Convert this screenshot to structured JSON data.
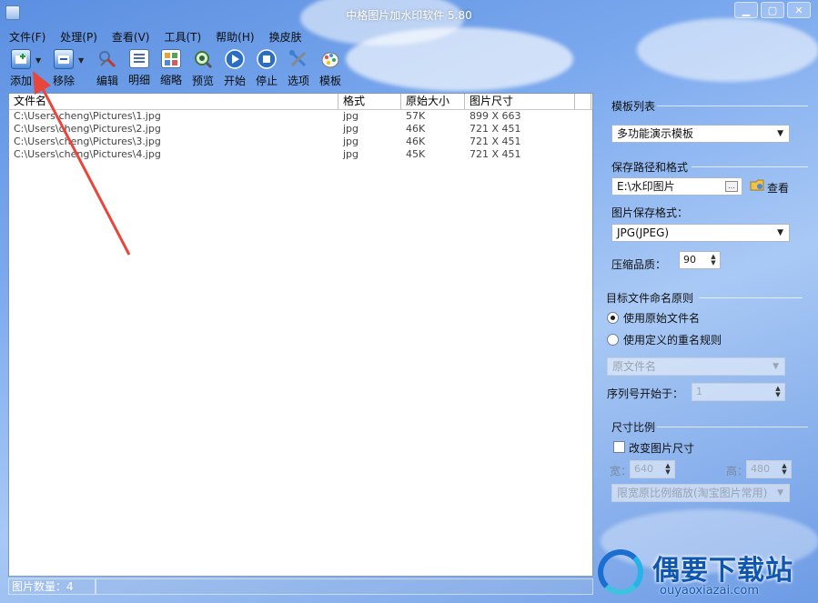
{
  "window": {
    "title": "中格图片加水印软件 5.80",
    "controls": [
      "▁",
      "▢",
      "✕"
    ]
  },
  "menu": [
    "文件(F)",
    "处理(P)",
    "查看(V)",
    "工具(T)",
    "帮助(H)",
    "换皮肤"
  ],
  "toolbar": [
    {
      "label": "添加",
      "icon": "add-image-icon",
      "dropdown": true
    },
    {
      "label": "移除",
      "icon": "remove-image-icon",
      "dropdown": true
    },
    {
      "label": "编辑",
      "icon": "edit-icon"
    },
    {
      "label": "明细",
      "icon": "detail-view-icon"
    },
    {
      "label": "缩略",
      "icon": "thumbnail-view-icon"
    },
    {
      "label": "预览",
      "icon": "preview-icon"
    },
    {
      "label": "开始",
      "icon": "play-icon"
    },
    {
      "label": "停止",
      "icon": "stop-icon"
    },
    {
      "label": "选项",
      "icon": "options-icon"
    },
    {
      "label": "模板",
      "icon": "template-icon"
    }
  ],
  "filelist": {
    "columns": [
      "文件名",
      "格式",
      "原始大小",
      "图片尺寸"
    ],
    "rows": [
      [
        "C:\\Users\\cheng\\Pictures\\1.jpg",
        "jpg",
        "57K",
        "899 X 663"
      ],
      [
        "C:\\Users\\cheng\\Pictures\\2.jpg",
        "jpg",
        "46K",
        "721 X 451"
      ],
      [
        "C:\\Users\\cheng\\Pictures\\3.jpg",
        "jpg",
        "46K",
        "721 X 451"
      ],
      [
        "C:\\Users\\cheng\\Pictures\\4.jpg",
        "jpg",
        "45K",
        "721 X 451"
      ]
    ]
  },
  "status": {
    "count_label": "图片数量：4"
  },
  "panel": {
    "template_title": "模板列表",
    "template_value": "多功能演示模板",
    "save_title": "保存路径和格式",
    "save_path": "E:\\水印图片",
    "view_label": "查看",
    "format_label": "图片保存格式：",
    "format_value": "JPG(JPEG)",
    "quality_label": "压缩品质：",
    "quality_value": "90",
    "naming_title": "目标文件命名原则",
    "naming_option1": "使用原始文件名",
    "naming_option2": "使用定义的重名规则",
    "naming_rule_value": "原文件名",
    "serial_label": "序列号开始于：",
    "serial_value": "1",
    "size_title": "尺寸比例",
    "resize_label": "改变图片尺寸",
    "width_label": "宽：",
    "width_value": "640",
    "height_label": "高：",
    "height_value": "480",
    "scale_mode_value": "限宽原比例缩放(淘宝图片常用)"
  },
  "watermark": {
    "text": "偶要下载站",
    "url": "ouyaoxiazai.com"
  },
  "colors": {
    "annotation_arrow": "#e8463a",
    "brand": "#0e56b0"
  }
}
